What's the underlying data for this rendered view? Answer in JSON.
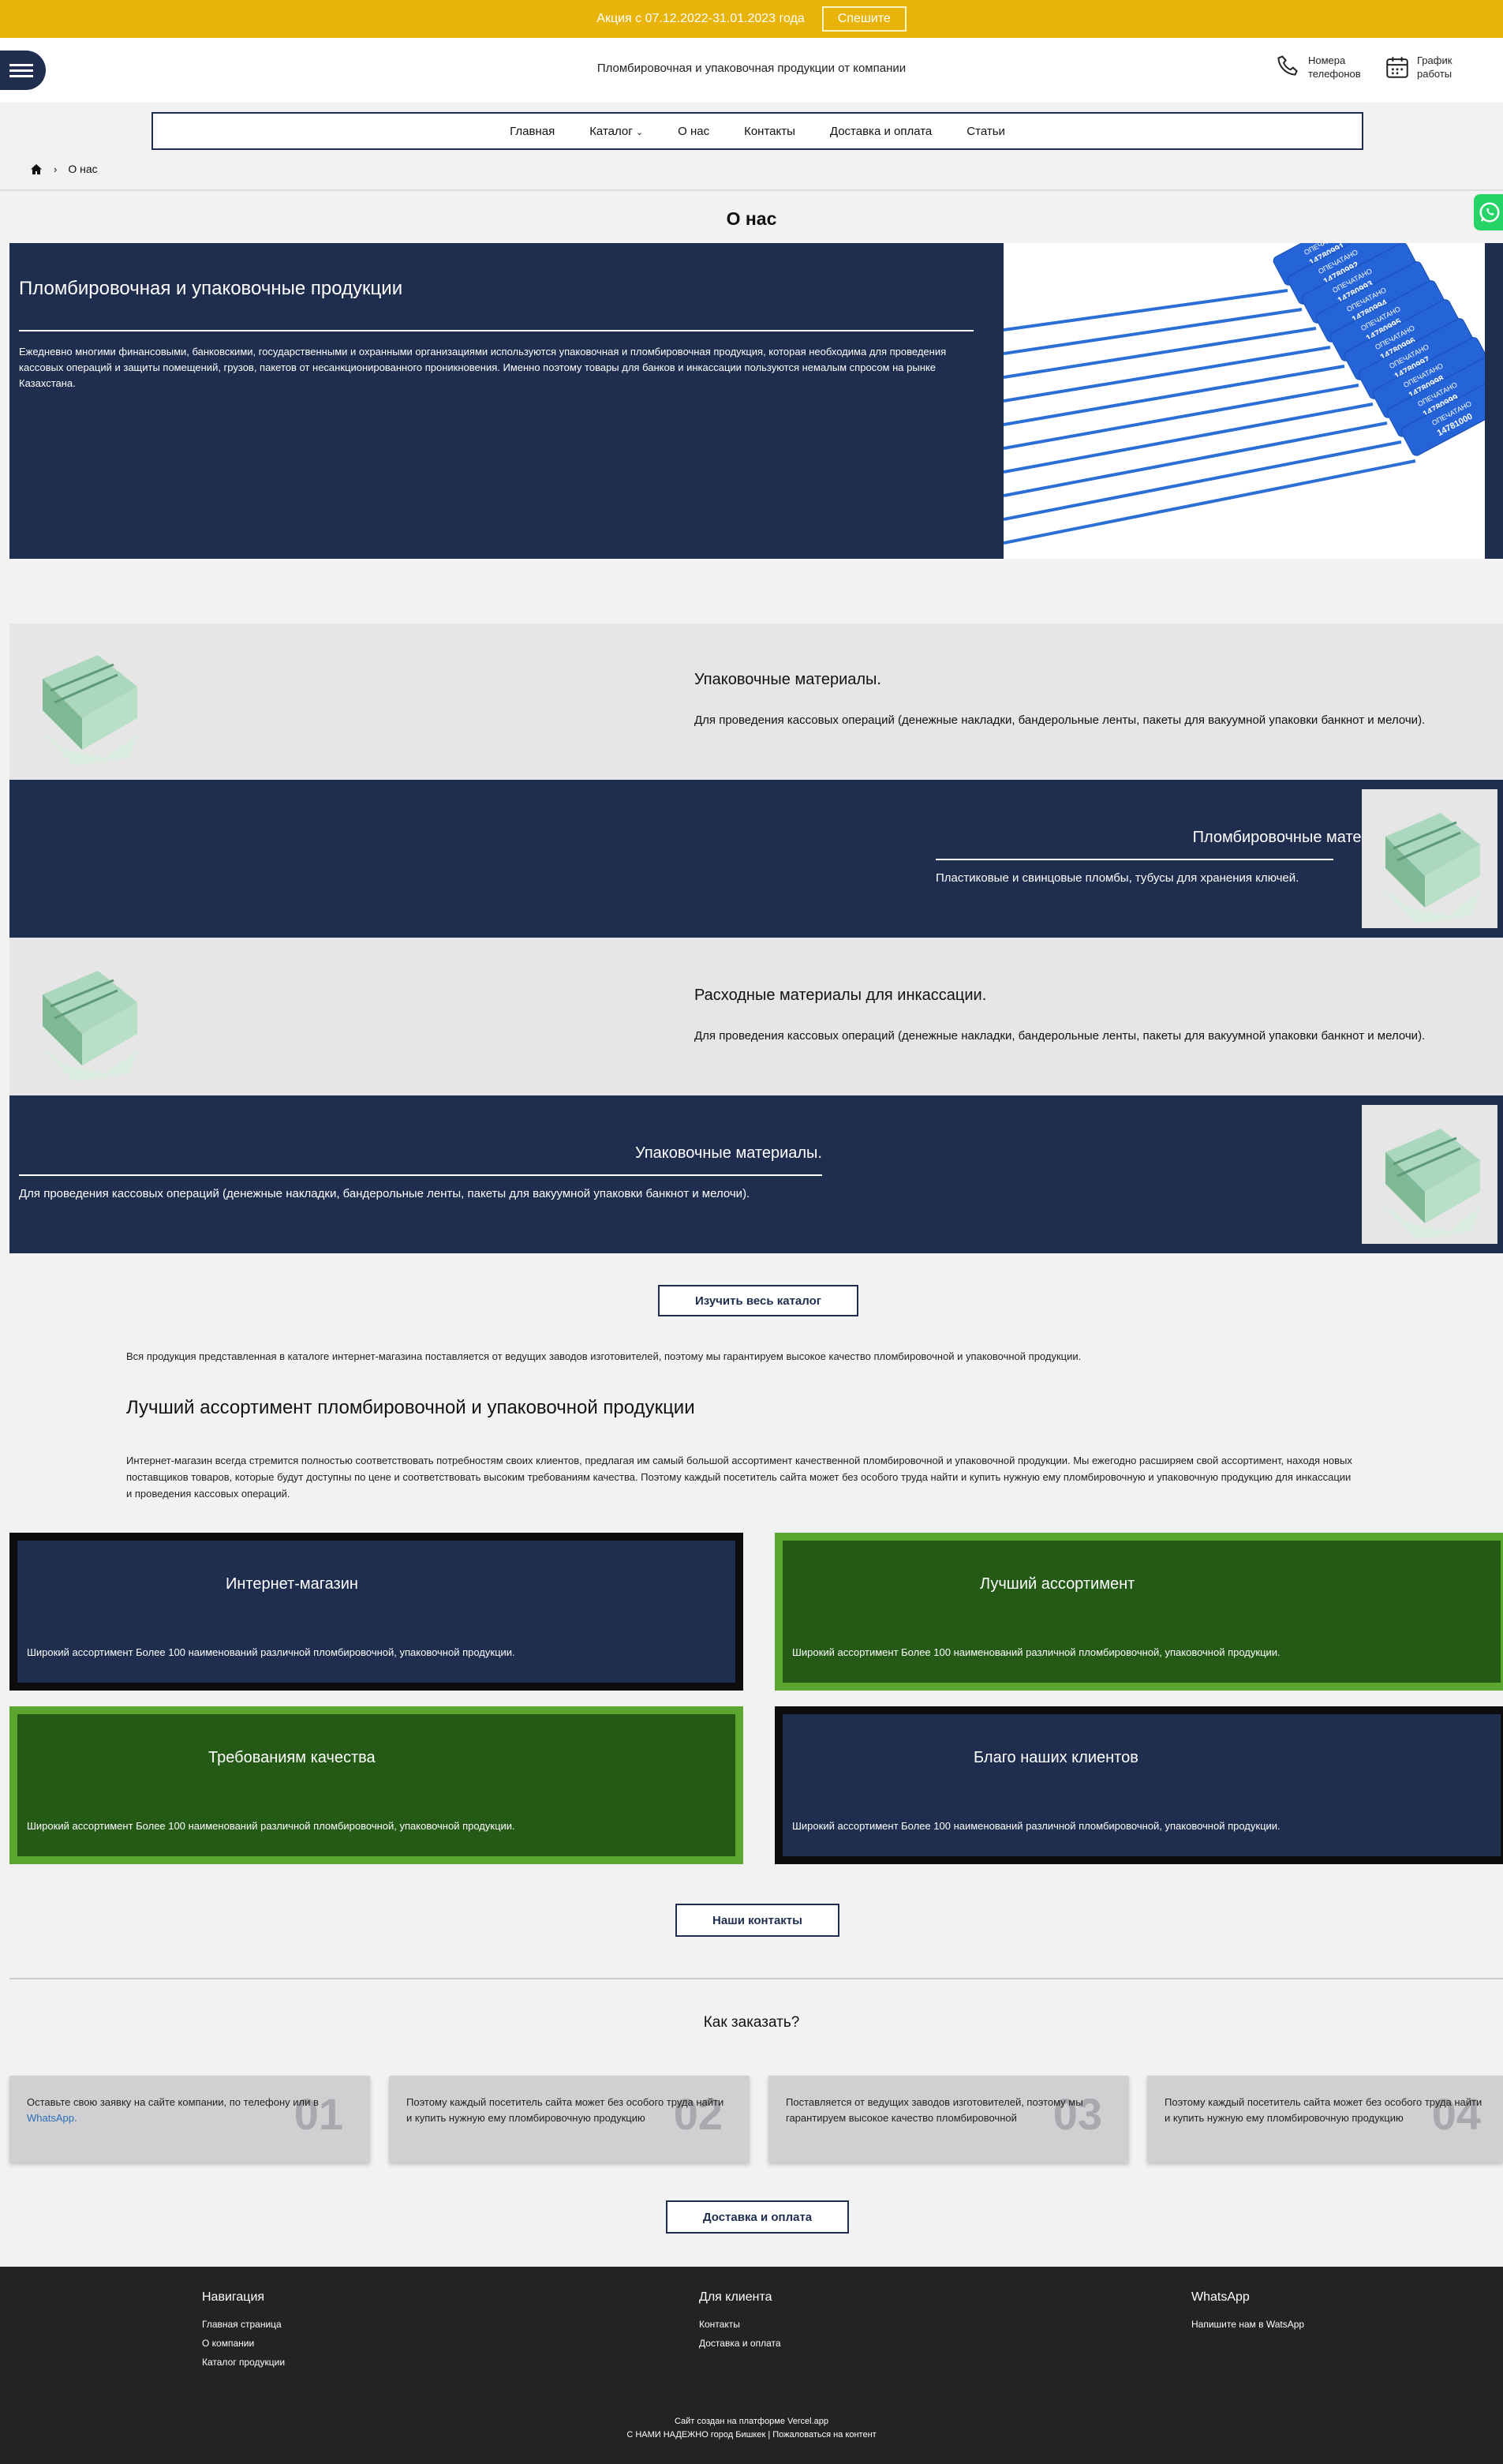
{
  "promo": {
    "text": "Акция с 07.12.2022-31.01.2023 года",
    "button": "Спешите"
  },
  "header": {
    "title": "Пломбировочная и упаковочная продукции от компании",
    "phones": [
      "Номера",
      "телефонов"
    ],
    "schedule": [
      "График",
      "работы"
    ]
  },
  "nav": {
    "items": [
      "Главная",
      "Каталог",
      "О нас",
      "Контакты",
      "Доставка и оплата",
      "Статьи"
    ]
  },
  "breadcrumb": {
    "current": "О нас"
  },
  "page": {
    "title": "О нас"
  },
  "hero": {
    "title": "Пломбировочная и упаковочные продукции",
    "text": "Ежедневно многими финансовыми, банковскими, государственными и охранными организациями используются упаковочная и пломбировочная продукция, которая необходима для проведения кассовых операций и защиты помещений, грузов, пакетов от несанкционированного проникновения. Именно поэтому товары для банков и инкассации пользуются немалым спросом на рынке Казахстана.",
    "seal_tags": [
      "14780991",
      "14780992",
      "14780993",
      "14780994",
      "14780995",
      "14780996",
      "14780997",
      "14780998",
      "14780999",
      "14781000"
    ],
    "seal_stamp": "ОПЕЧАТАНО"
  },
  "rows": [
    {
      "title": "Упаковочные материалы.",
      "desc": "Для проведения кассовых операций (денежные накладки, бандерольные ленты, пакеты для вакуумной упаковки банкнот и мелочи)."
    },
    {
      "title": "Пломбировочные материалы",
      "desc": "Пластиковые и свинцовые пломбы, тубусы для хранения ключей."
    },
    {
      "title": "Расходные материалы для инкассации.",
      "desc": "Для проведения кассовых операций (денежные накладки, бандерольные ленты, пакеты для вакуумной упаковки банкнот и мелочи)."
    },
    {
      "title": "Упаковочные материалы.",
      "desc": "Для проведения кассовых операций (денежные накладки, бандерольные ленты, пакеты для вакуумной упаковки банкнот и мелочи)."
    }
  ],
  "catalog_button": "Изучить весь каталог",
  "intro": "Вся продукция представленная в каталоге интернет-магазина поставляется от ведущих заводов изготовителей, поэтому мы гарантируем высокое качество пломбировочной и упаковочной продукции.",
  "assortment": {
    "title": "Лучший ассортимент пломбировочной и упаковочной продукции",
    "text": "Интернет-магазин всегда стремится полностью соответствовать потребностям своих клиентов, предлагая им самый большой ассортимент качественной пломбировочной и упаковочной продукции. Мы ежегодно расширяем свой ассортимент, находя новых поставщиков товаров, которые будут доступны по цене и соответствовать высоким требованиям качества. Поэтому каждый посетитель сайта может без особого труда найти и купить нужную ему пломбировочную и упаковочную продукцию для инкассации и проведения кассовых операций."
  },
  "cards": [
    {
      "title": "Интернет-магазин",
      "text": "Широкий ассортимент Более 100 наименований различной пломбировочной, упаковочной продукции."
    },
    {
      "title": "Лучший ассортимент",
      "text": "Широкий ассортимент Более 100 наименований различной пломбировочной, упаковочной продукции."
    },
    {
      "title": "Требованиям качества",
      "text": "Широкий ассортимент Более 100 наименований различной пломбировочной, упаковочной продукции."
    },
    {
      "title": "Благо наших клиентов",
      "text": "Широкий ассортимент Более 100 наименований различной пломбировочной, упаковочной продукции."
    }
  ],
  "contacts_button": "Наши контакты",
  "order": {
    "title": "Как заказать?",
    "steps": [
      {
        "num": "01",
        "text": "Оставьте свою заявку на сайте компании, по телефону или в",
        "link": "WhatsApp."
      },
      {
        "num": "02",
        "text": "Поэтому каждый посетитель сайта может без особого труда найти и купить нужную ему пломбировочную продукцию"
      },
      {
        "num": "03",
        "text": "Поставляется от ведущих заводов изготовителей, поэтому мы гарантируем высокое качество пломбировочной"
      },
      {
        "num": "04",
        "text": "Поэтому каждый посетитель сайта может без особого труда найти и купить нужную ему пломбировочную продукцию"
      }
    ]
  },
  "delivery_button": "Доставка и оплата",
  "footer": {
    "nav_title": "Навигация",
    "nav_links": [
      "Главная страница",
      "О компании",
      "Каталог продукции"
    ],
    "client_title": "Для клиента",
    "client_links": [
      "Контакты",
      "Доставка и оплата"
    ],
    "wa_title": "WhatsApp",
    "wa_links": [
      "Напишите нам в WatsApp"
    ],
    "bottom1": "Сайт создан на платформе Vercel.app",
    "bottom2": "С НАМИ НАДЕЖНО город Бишкек | Пожаловаться на контент"
  },
  "colors": {
    "navy": "#1f2d4f",
    "promo": "#e8b40a",
    "green": "#245a16",
    "green_border": "#5aa62e",
    "footer": "#232323"
  }
}
